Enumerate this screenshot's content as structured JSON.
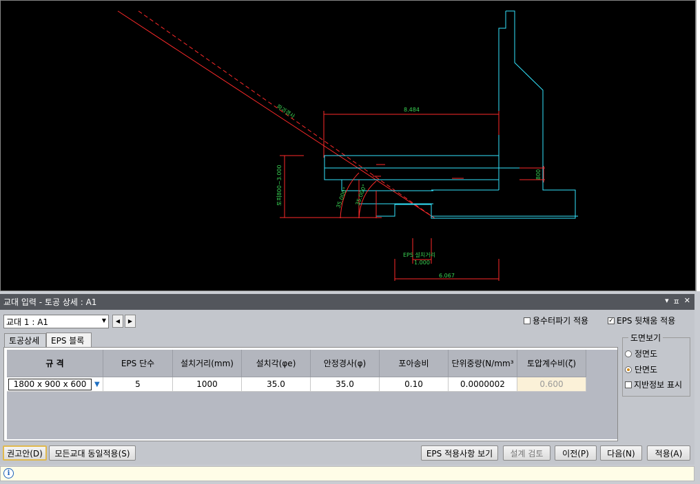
{
  "window": {
    "title": "교대 입력 - 토공 상세 : A1",
    "controls": {
      "dropdown": "▾",
      "pin": "ㅍ",
      "close": "✕"
    }
  },
  "drawing": {
    "labels": {
      "slope_text": "파괴경사",
      "dim_top": "8.484",
      "dim_left": "토피800~3.000",
      "angle1": "35.000°",
      "angle2": "35.000°",
      "dim_right": "800",
      "eps_install": "EPS 설치거리",
      "dim_1000": "1.000",
      "dim_bottom": "6.067"
    }
  },
  "toolbar": {
    "abutment_combo": "교대 1 : A1",
    "prev_arrow": "◀",
    "next_arrow": "▶",
    "check_drain": {
      "label": "용수터파기 적용",
      "checked": false
    },
    "check_eps_fill": {
      "label": "EPS 뒷채움 적용",
      "checked": true
    }
  },
  "tabs": [
    {
      "label": "토공상세",
      "active": false
    },
    {
      "label": "EPS 블록",
      "active": true
    }
  ],
  "grid": {
    "columns": [
      "규 격",
      "EPS 단수",
      "설치거리(mm)",
      "설치각(φe)",
      "안정경사(φ)",
      "포아송비",
      "단위중량(N/mm³",
      "토압계수비(ζ)"
    ],
    "row": {
      "spec": "1800 x 900 x 600",
      "eps_tiers": "5",
      "install_distance": "1000",
      "install_angle": "35.0",
      "stable_slope": "35.0",
      "poisson": "0.10",
      "unit_weight": "0.0000002",
      "pressure_ratio": "0.600"
    }
  },
  "view_group": {
    "title": "도면보기",
    "front": {
      "label": "정면도",
      "selected": false
    },
    "section": {
      "label": "단면도",
      "selected": true
    },
    "ground_info": {
      "label": "지반정보 표시",
      "checked": false
    }
  },
  "buttons": {
    "recommend": "권고안(D)",
    "apply_all": "모든교대 동일적용(S)",
    "eps_view": "EPS 적용사항 보기",
    "design_check": "설계 검토",
    "prev": "이전(P)",
    "next": "다음(N)",
    "apply": "적용(A)"
  },
  "info": {
    "icon": "i",
    "message": ""
  },
  "colors": {
    "cad_bg": "#000000",
    "structure": "#33e6ff",
    "slope_line": "#ff2a2a",
    "dimension": "#ff2a2a",
    "text": "#39d353",
    "panel": "#c3c6cc",
    "readonly_cell": "#fbf1d8"
  }
}
